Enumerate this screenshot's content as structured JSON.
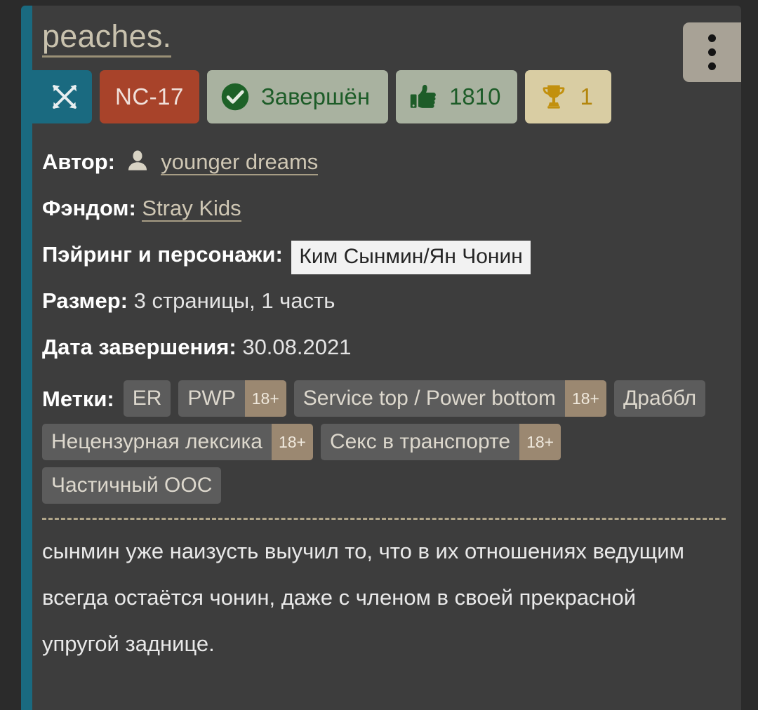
{
  "card": {
    "title": "peaches.",
    "menu_button": {
      "name": "more-options",
      "dots": 3
    }
  },
  "badges": {
    "direction": {
      "icon": "crossed-arrows-icon",
      "label": ""
    },
    "rating": {
      "label": "NC-17"
    },
    "status": {
      "icon": "check-circle-icon",
      "label": "Завершён"
    },
    "likes": {
      "icon": "thumbs-up-icon",
      "value": "1810"
    },
    "awards": {
      "icon": "trophy-icon",
      "value": "1"
    }
  },
  "meta": {
    "author_label": "Автор:",
    "author_name": "younger dreams",
    "fandom_label": "Фэндом:",
    "fandom_name": "Stray Kids",
    "pairing_label": "Пэйринг и персонажи:",
    "pairing_value": "Ким Сынмин/Ян Чонин",
    "size_label": "Размер:",
    "size_value": "3 страницы, 1 часть",
    "date_label": "Дата завершения:",
    "date_value": "30.08.2021"
  },
  "tags": {
    "label": "Метки:",
    "items": [
      {
        "text": "ER",
        "adult": ""
      },
      {
        "text": "PWP",
        "adult": "18+"
      },
      {
        "text": "Service top / Power bottom",
        "adult": "18+"
      },
      {
        "text": "Драббл",
        "adult": ""
      },
      {
        "text": "Нецензурная лексика",
        "adult": "18+"
      },
      {
        "text": "Секс в транспорте",
        "adult": "18+"
      },
      {
        "text": "Частичный ООС",
        "adult": ""
      }
    ]
  },
  "description": "сынмин уже наизусть выучил то, что в их отношениях ведущим всегда остаётся чонин, даже с членом в своей прекрасной упругой заднице.",
  "colors": {
    "page_background": "#2b2b2b",
    "card_background": "#3d3d3d",
    "accent_bar": "#1a6a80",
    "rating": "#a8432a",
    "status_badge": "#a9b2a0",
    "status_text": "#1d5c28",
    "award_badge": "#d9cda3",
    "award_text": "#b3860d",
    "tag_background": "#5c5c5c",
    "tag_adult": "#9b8871",
    "title_text": "#c9c2ae",
    "menu_button": "#a8a296"
  }
}
